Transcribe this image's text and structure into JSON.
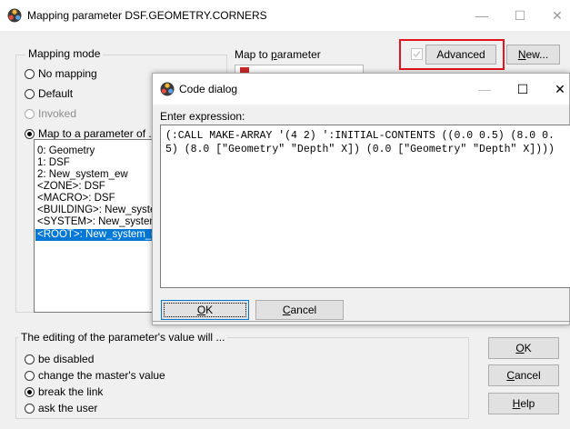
{
  "main_window": {
    "title": "Mapping parameter DSF.GEOMETRY.CORNERS",
    "min_glyph": "—",
    "max_glyph": "☐",
    "close_glyph": "✕"
  },
  "mapping_mode": {
    "legend": "Mapping mode",
    "options": [
      {
        "label": "No mapping",
        "selected": false,
        "enabled": true
      },
      {
        "label": "Default",
        "selected": false,
        "enabled": true
      },
      {
        "label": "Invoked",
        "selected": false,
        "enabled": false
      },
      {
        "label": "Map to a parameter of ...",
        "selected": true,
        "enabled": true
      }
    ],
    "list_items": [
      "0: Geometry",
      "1: DSF",
      "2: New_system_ew",
      "<ZONE>: DSF",
      "<MACRO>: DSF",
      "<BUILDING>: New_system_ew",
      "<SYSTEM>: New_system_ew",
      "<ROOT>: New_system_ew"
    ],
    "selected_index": 7
  },
  "map_to_parameter": {
    "label_prefix": "Map to ",
    "label_underlined": "p",
    "label_suffix": "arameter",
    "advanced_label": "Advanced",
    "advanced_checked": true,
    "new_label_underlined": "N",
    "new_label_suffix": "ew..."
  },
  "editing": {
    "legend": "The editing of the parameter's value will ...",
    "options": [
      {
        "label": "be disabled",
        "selected": false
      },
      {
        "label": "change the master's value",
        "selected": false
      },
      {
        "label": "break the link",
        "selected": true
      },
      {
        "label": "ask the user",
        "selected": false
      }
    ]
  },
  "main_buttons": {
    "ok_underlined": "O",
    "ok_suffix": "K",
    "cancel_underlined": "C",
    "cancel_suffix": "ancel",
    "help_underlined": "H",
    "help_suffix": "elp"
  },
  "code_dialog": {
    "title": "Code dialog",
    "prompt": "Enter expression:",
    "expression": "(:CALL MAKE-ARRAY '(4 2) ':INITIAL-CONTENTS ((0.0 0.5) (8.0 0.5) (8.0 [\"Geometry\" \"Depth\" X]) (0.0 [\"Geometry\" \"Depth\" X])))",
    "ok_underlined": "O",
    "ok_suffix": "K",
    "cancel_underlined": "C",
    "cancel_suffix": "ancel",
    "min_glyph": "—",
    "max_glyph": "☐",
    "close_glyph": "✕"
  },
  "colors": {
    "selection": "#0078d7",
    "highlight_box": "#e3141c",
    "window_bg": "#f0f0f0"
  }
}
